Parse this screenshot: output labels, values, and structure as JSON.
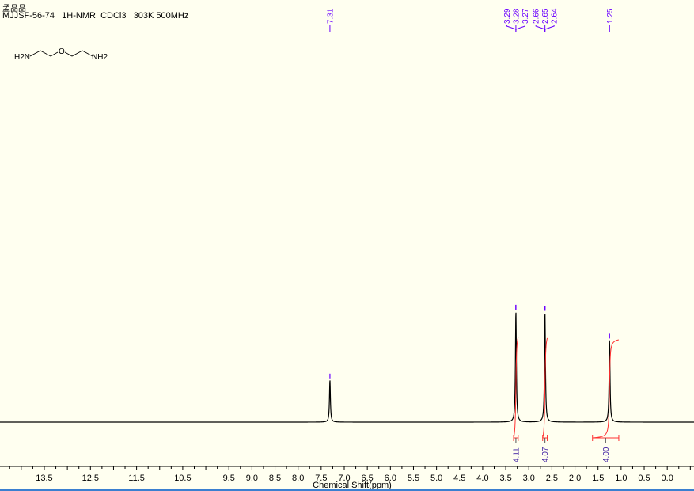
{
  "header": {
    "sample_name": "孟晶晶",
    "title": "MJJSF-56-74   1H-NMR  CDCl3   303K 500MHz"
  },
  "molecule": {
    "left_group": "H2N",
    "oxygen": "O",
    "right_group": "NH2"
  },
  "colors": {
    "background": "#fffff0",
    "spectrum": "#000000",
    "peak_labels": "#6a00ff",
    "integral_curve": "#ff3030",
    "integral_labels": "#3a1aa0"
  },
  "chart_data": {
    "type": "line",
    "title": "",
    "xlabel": "Chemical Shift(ppm)",
    "ylabel": "",
    "xlim": [
      14.46,
      -0.58
    ],
    "x_reversed": true,
    "grid": false,
    "x_tick_labels": [
      "13.5",
      "12.5",
      "11.5",
      "10.5",
      "9.5",
      "9.0",
      "8.5",
      "8.0",
      "7.5",
      "7.0",
      "6.5",
      "6.0",
      "5.5",
      "5.0",
      "4.5",
      "4.0",
      "3.5",
      "3.0",
      "2.5",
      "2.0",
      "1.5",
      "1.0",
      "0.5",
      "0.0"
    ],
    "peaks": [
      {
        "ppm": 7.31,
        "relative_height": 0.38
      },
      {
        "ppm": 3.28,
        "relative_height": 1.0
      },
      {
        "ppm": 2.65,
        "relative_height": 0.99
      },
      {
        "ppm": 1.25,
        "relative_height": 0.74
      }
    ],
    "peak_label_groups": [
      {
        "labels": [
          "7.31"
        ],
        "ppm": 7.31
      },
      {
        "labels": [
          "3.29",
          "3.28",
          "3.27"
        ],
        "ppm": 3.28
      },
      {
        "labels": [
          "2.66",
          "2.65",
          "2.64"
        ],
        "ppm": 2.65
      },
      {
        "labels": [
          "1.25"
        ],
        "ppm": 1.25
      }
    ],
    "integrals": [
      {
        "from": 3.33,
        "to": 3.23,
        "value": "4.11"
      },
      {
        "from": 2.7,
        "to": 2.6,
        "value": "4.07"
      },
      {
        "from": 1.62,
        "to": 1.05,
        "value": "4.00"
      }
    ]
  }
}
